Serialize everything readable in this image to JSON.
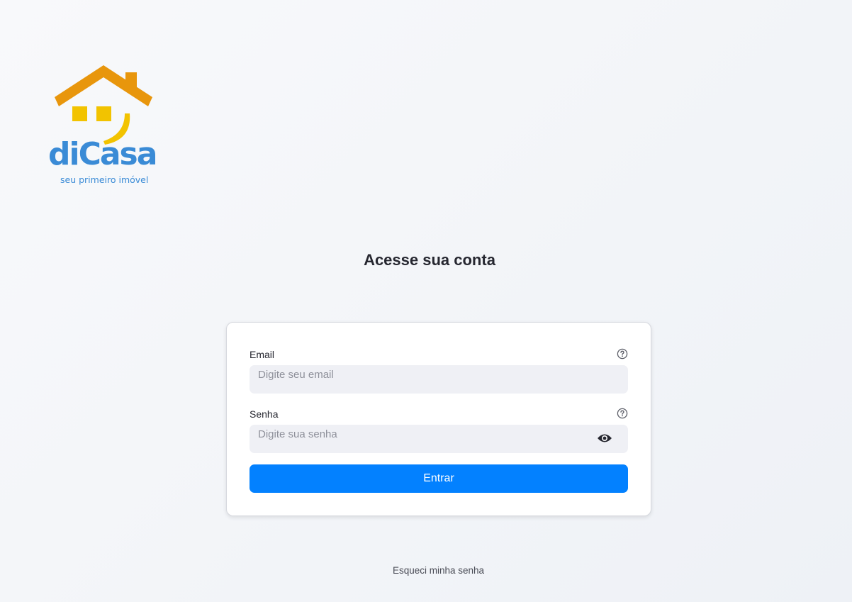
{
  "brand": {
    "name": "diCasa",
    "tagline": "seu primeiro imóvel",
    "colors": {
      "roof": "#e8960c",
      "window": "#f2c300",
      "text": "#3a8bd6"
    }
  },
  "login": {
    "title": "Acesse sua conta",
    "email": {
      "label": "Email",
      "placeholder": "Digite seu email",
      "value": "",
      "help_icon": "question-circle-icon"
    },
    "password": {
      "label": "Senha",
      "placeholder": "Digite sua senha",
      "value": "",
      "help_icon": "question-circle-icon",
      "toggle_icon": "eye-icon"
    },
    "submit_label": "Entrar",
    "forgot_label": "Esqueci minha senha",
    "accent_color": "#0381ff"
  }
}
